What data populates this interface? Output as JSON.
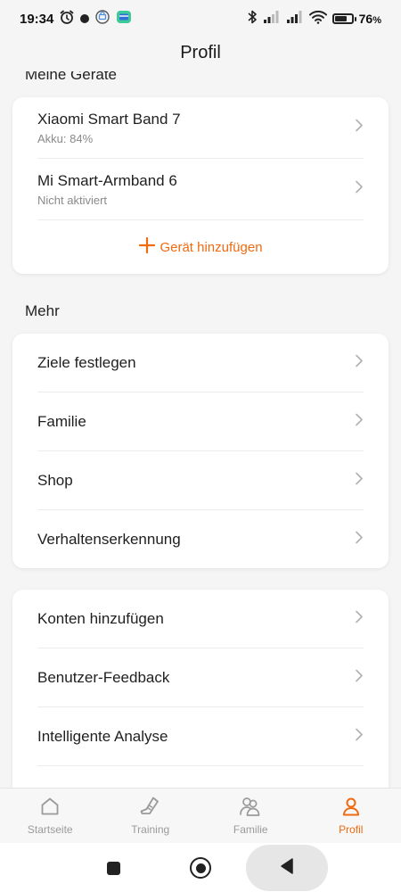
{
  "status_bar": {
    "time": "19:34",
    "battery_percent": "76",
    "battery_unit": "%",
    "battery_level": 0.76,
    "left_icons": [
      "alarm-icon",
      "dot-icon",
      "vpn-icon",
      "wallet-app-icon"
    ],
    "right_icons": [
      "bluetooth-icon",
      "signal-icon",
      "signal-icon",
      "wifi-icon",
      "battery-icon"
    ]
  },
  "header": {
    "title": "Profil"
  },
  "devices": {
    "section_title": "Meine Geräte",
    "items": [
      {
        "name": "Xiaomi Smart Band 7",
        "status": "Akku: 84%"
      },
      {
        "name": "Mi Smart-Armband 6",
        "status": "Nicht aktiviert"
      }
    ],
    "add_label": "Gerät hinzufügen"
  },
  "more": {
    "section_title": "Mehr",
    "items": [
      {
        "label": "Ziele festlegen"
      },
      {
        "label": "Familie"
      },
      {
        "label": "Shop"
      },
      {
        "label": "Verhaltenserkennung"
      }
    ]
  },
  "other": {
    "items": [
      {
        "label": "Konten hinzufügen"
      },
      {
        "label": "Benutzer-Feedback"
      },
      {
        "label": "Intelligente Analyse"
      }
    ]
  },
  "bottom_nav": {
    "items": [
      {
        "label": "Startseite",
        "icon": "home-icon",
        "active": false
      },
      {
        "label": "Training",
        "icon": "shoe-icon",
        "active": false
      },
      {
        "label": "Familie",
        "icon": "family-icon",
        "active": false
      },
      {
        "label": "Profil",
        "icon": "profile-icon",
        "active": true
      }
    ]
  },
  "colors": {
    "accent": "#f06a10",
    "background": "#f5f5f5",
    "card": "#ffffff",
    "secondary_text": "#8a8a8a",
    "inactive_nav": "#9a9a9a"
  }
}
